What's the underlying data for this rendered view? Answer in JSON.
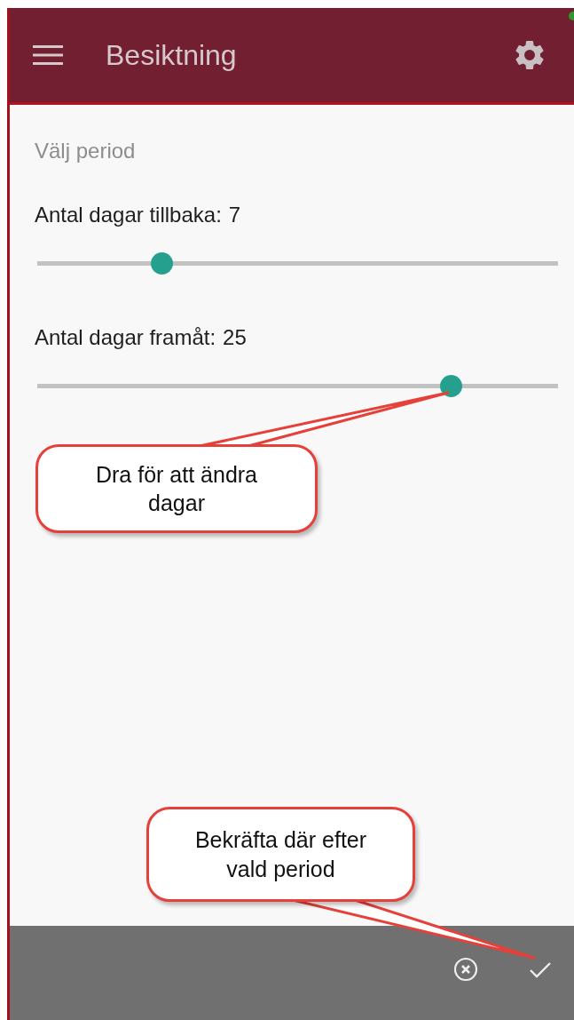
{
  "app_bar": {
    "title": "Besiktning"
  },
  "section_title": "Välj period",
  "sliders": [
    {
      "label": "Antal dagar tillbaka:",
      "value": "7",
      "level": 0.238
    },
    {
      "label": "Antal dagar framåt:",
      "value": "25",
      "level": 0.794
    }
  ],
  "callouts": [
    {
      "text": "Dra för att ändra dagar"
    },
    {
      "text": "Bekräfta där efter vald period"
    }
  ]
}
